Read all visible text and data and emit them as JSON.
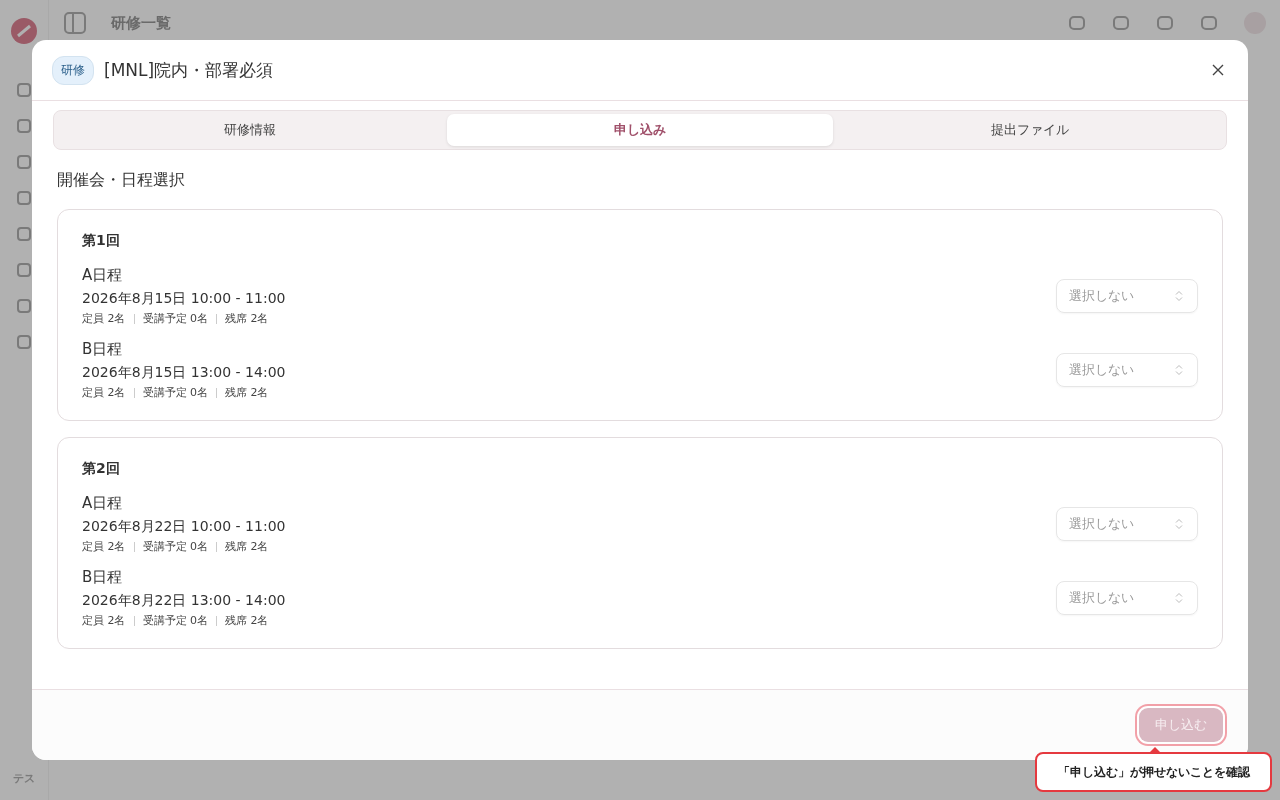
{
  "app": {
    "page_title": "研修一覧",
    "user_initials": "テス"
  },
  "dialog": {
    "badge": "研修",
    "title": "[MNL]院内・部署必須",
    "tabs": [
      {
        "label": "研修情報",
        "selected": false
      },
      {
        "label": "申し込み",
        "selected": true
      },
      {
        "label": "提出ファイル",
        "selected": false
      }
    ],
    "section_title": "開催会・日程選択",
    "sessions": [
      {
        "title": "第1回",
        "schedules": [
          {
            "name": "A日程",
            "datetime": "2026年8月15日 10:00 - 11:00",
            "capacity": "定員 2名",
            "planned": "受講予定 0名",
            "remaining": "残席 2名",
            "select_value": "選択しない"
          },
          {
            "name": "B日程",
            "datetime": "2026年8月15日 13:00 - 14:00",
            "capacity": "定員 2名",
            "planned": "受講予定 0名",
            "remaining": "残席 2名",
            "select_value": "選択しない"
          }
        ]
      },
      {
        "title": "第2回",
        "schedules": [
          {
            "name": "A日程",
            "datetime": "2026年8月22日 10:00 - 11:00",
            "capacity": "定員 2名",
            "planned": "受講予定 0名",
            "remaining": "残席 2名",
            "select_value": "選択しない"
          },
          {
            "name": "B日程",
            "datetime": "2026年8月22日 13:00 - 14:00",
            "capacity": "定員 2名",
            "planned": "受講予定 0名",
            "remaining": "残席 2名",
            "select_value": "選択しない"
          }
        ]
      }
    ],
    "submit": {
      "label": "申し込む",
      "disabled": true
    }
  },
  "annotation": {
    "text": "「申し込む」が押せないことを確認"
  }
}
